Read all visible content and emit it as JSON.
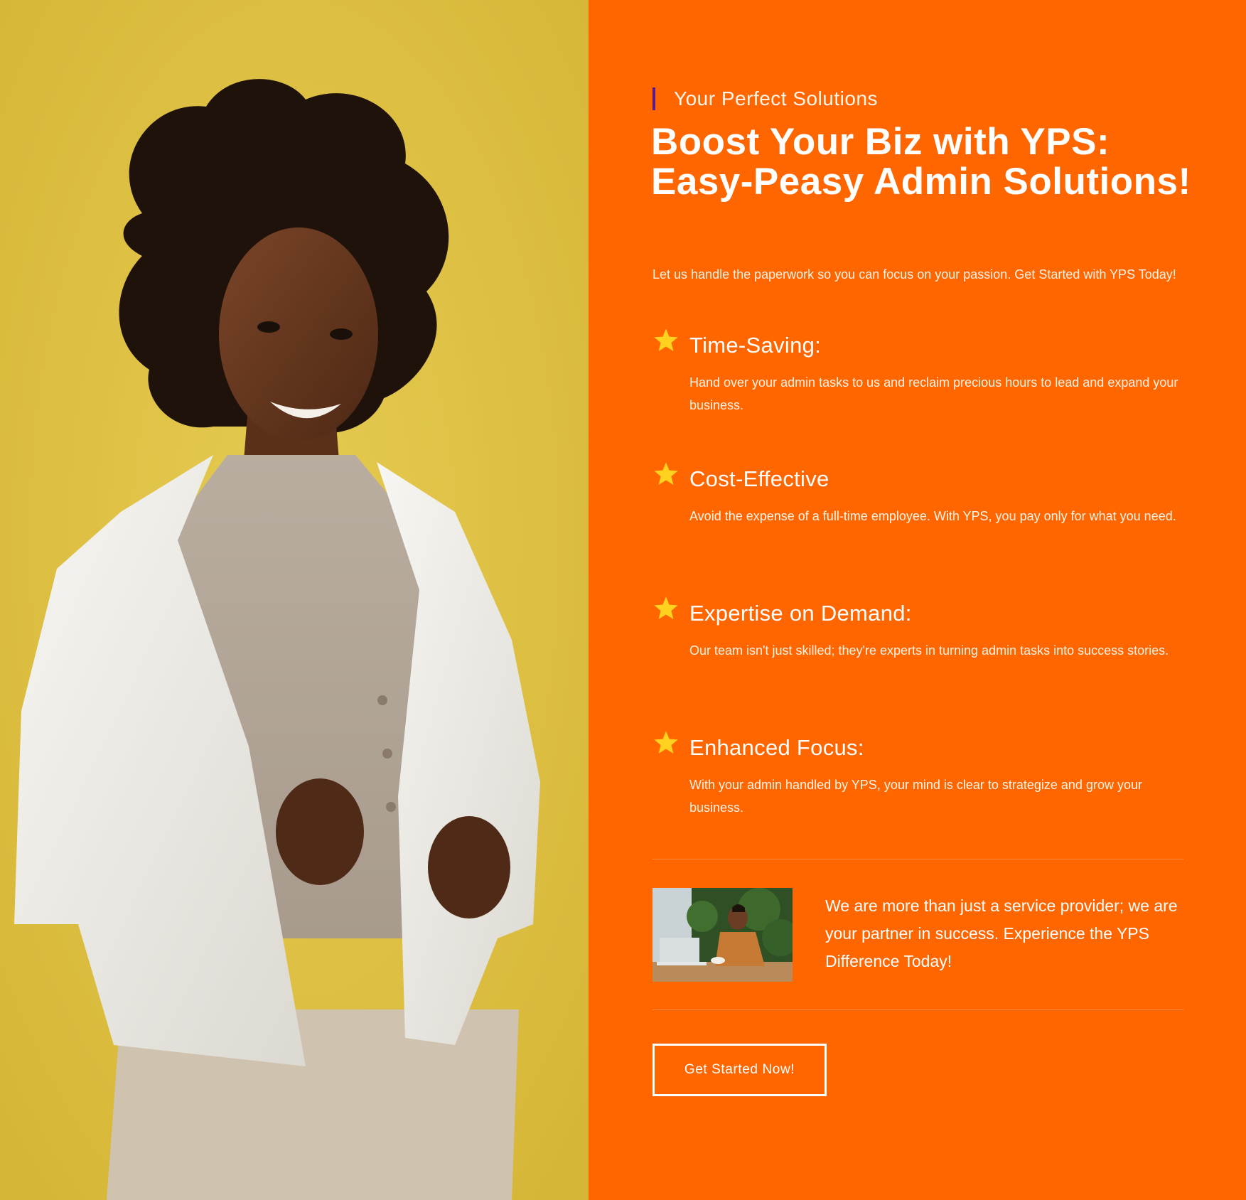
{
  "colors": {
    "accent": "#ff6600",
    "photo_background": "#e0c244",
    "eyebrow_bar": "#5b1a8c",
    "star": "#ffd21f",
    "text": "#ffffff"
  },
  "hero": {
    "eyebrow": "Your Perfect Solutions",
    "headline": "Boost Your Biz with YPS: Easy-Peasy Admin Solutions!",
    "intro": "Let us handle the paperwork so you can focus on your passion. Get Started with YPS Today!"
  },
  "features": [
    {
      "icon": "star-icon",
      "title": "Time-Saving:",
      "description": "Hand over your admin tasks to us and reclaim precious hours to lead and expand your business."
    },
    {
      "icon": "star-icon",
      "title": "Cost-Effective",
      "description": "Avoid the expense of a full-time employee. With YPS, you pay only for what you need."
    },
    {
      "icon": "star-icon",
      "title": "Expertise on Demand:",
      "description": "Our team isn't just skilled; they're experts in turning admin tasks into success stories."
    },
    {
      "icon": "star-icon",
      "title": "Enhanced Focus:",
      "description": "With your admin handled by YPS, your mind is clear to strategize and grow your business."
    }
  ],
  "promo": {
    "text": "We are more than just a service provider; we are your partner in success. Experience the YPS Difference Today!"
  },
  "cta": {
    "label": "Get Started Now!"
  }
}
